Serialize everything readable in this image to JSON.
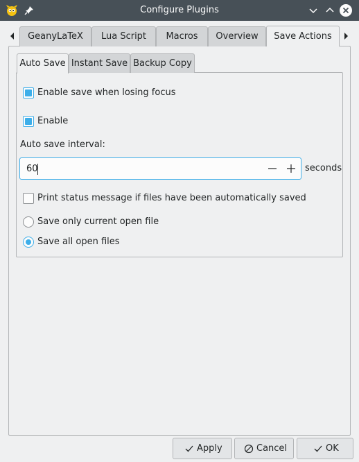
{
  "window": {
    "title": "Configure Plugins"
  },
  "outer_tabs": [
    "GeanyLaTeX",
    "Lua Script",
    "Macros",
    "Overview",
    "Save Actions"
  ],
  "inner_tabs": [
    "Auto Save",
    "Instant Save",
    "Backup Copy"
  ],
  "auto_save": {
    "enable_on_focus_loss_label": "Enable save when losing focus",
    "enable_on_focus_loss": true,
    "enable_label": "Enable",
    "enable": true,
    "interval_label": "Auto save interval:",
    "interval_value": "60",
    "interval_unit": "seconds",
    "print_status_label": "Print status message if files have been automatically saved",
    "print_status": false,
    "save_current_label": "Save only current open file",
    "save_all_label": "Save all open files",
    "save_mode": "all"
  },
  "buttons": {
    "apply": "Apply",
    "cancel": "Cancel",
    "ok": "OK"
  },
  "colors": {
    "accent": "#3daee9",
    "titlebar": "#475057",
    "window": "#eff0f1"
  }
}
